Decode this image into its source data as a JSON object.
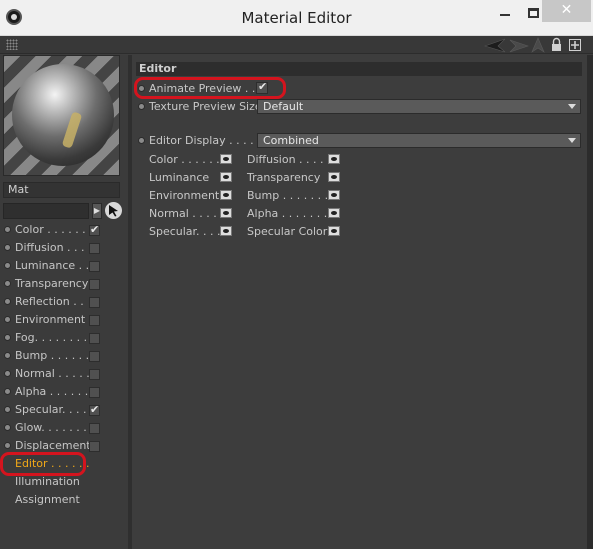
{
  "window": {
    "title": "Material Editor"
  },
  "material": {
    "name": "Mat"
  },
  "channels": [
    {
      "label": "Color . . . . . .",
      "checked": true
    },
    {
      "label": "Diffusion . . .",
      "checked": false
    },
    {
      "label": "Luminance . .",
      "checked": false
    },
    {
      "label": "Transparency",
      "checked": false
    },
    {
      "label": "Reflection . .",
      "checked": false
    },
    {
      "label": "Environment",
      "checked": false
    },
    {
      "label": "Fog. . . . . . . .",
      "checked": false
    },
    {
      "label": "Bump . . . . . .",
      "checked": false
    },
    {
      "label": "Normal . . . . .",
      "checked": false
    },
    {
      "label": "Alpha . . . . . .",
      "checked": false
    },
    {
      "label": "Specular. . . .",
      "checked": true
    },
    {
      "label": "Glow. . . . . . .",
      "checked": false
    },
    {
      "label": "Displacement",
      "checked": false
    }
  ],
  "pages": [
    {
      "label": "Editor . . . . . .",
      "active": true
    },
    {
      "label": "Illumination",
      "active": false
    },
    {
      "label": "Assignment",
      "active": false
    }
  ],
  "editor": {
    "section_title": "Editor",
    "animate_preview_label": "Animate Preview . . .",
    "animate_preview_checked": true,
    "texture_preview_size_label": "Texture Preview Size",
    "texture_preview_size_value": "Default",
    "editor_display_label": "Editor Display . . . . .",
    "editor_display_value": "Combined",
    "display_channels_left": [
      "Color . . . . . .",
      "Luminance",
      "Environment",
      "Normal . . . .",
      "Specular. . . ."
    ],
    "display_channels_right": [
      "Diffusion . . . .",
      "Transparency",
      "Bump . . . . . . .",
      "Alpha . . . . . . .",
      "Specular Color"
    ]
  },
  "colors": {
    "active_page": "#f0a818",
    "highlight_mark": "#d4141e"
  }
}
